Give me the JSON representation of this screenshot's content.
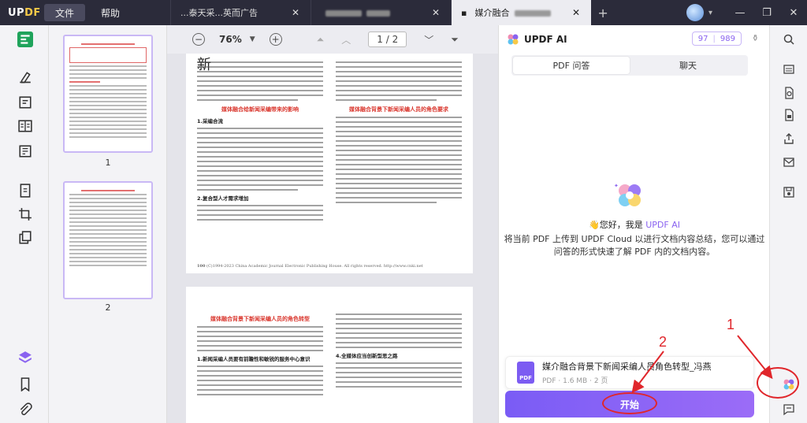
{
  "app": {
    "logo_left": "UP",
    "logo_right": "DF"
  },
  "menu": {
    "file": "文件",
    "help": "帮助"
  },
  "tabs": [
    {
      "title": "...泰天采...英而广告"
    },
    {
      "title": ""
    },
    {
      "title": "媒介融合"
    }
  ],
  "toolbar": {
    "zoom": "76%",
    "page_current": "1",
    "page_total": "2",
    "page_display": "1 / 2"
  },
  "thumbnails": [
    {
      "label": "1"
    },
    {
      "label": "2"
    }
  ],
  "document": {
    "page1": {
      "lead_char": "新",
      "section_heading_left": "媒体融合给新闻采编带来的影响",
      "sub1": "1.采编合流",
      "sub2": "2.复合型人才需求增加",
      "section_heading_right": "媒体融合背景下新闻采编人员的角色要求",
      "footer": "(C)1994-2023 China Academic Journal Electronic Publishing House. All rights reserved.   http://www.cnki.net",
      "page_num": "100"
    },
    "page2": {
      "heading": "媒体融合背景下新闻采编人员的角色转型",
      "sub1": "1.新闻采编人员要有前瞻性和敏锐的服务中心意识",
      "sub2": "4.全媒体应当创新型思之路"
    }
  },
  "ai_panel": {
    "title": "UPDF AI",
    "counter_a": "97",
    "counter_b": "989",
    "tab_pdf": "PDF 问答",
    "tab_chat": "聊天",
    "welcome_prefix": "👋您好，我是 ",
    "welcome_brand": "UPDF AI",
    "description": "将当前 PDF 上传到 UPDF Cloud 以进行文档内容总结，您可以通过问答的形式快速了解 PDF 内的文档内容。",
    "file_name": "媒介融合背景下新闻采编人员角色转型_冯燕",
    "file_meta": "PDF · 1.6 MB · 2 页",
    "pdf_label": "PDF",
    "start_button": "开始"
  },
  "annotations": {
    "one": "1",
    "two": "2"
  },
  "colors": {
    "accent": "#8a63f0",
    "annotation_red": "#e0262b",
    "titlebar": "#2b2b3a"
  }
}
